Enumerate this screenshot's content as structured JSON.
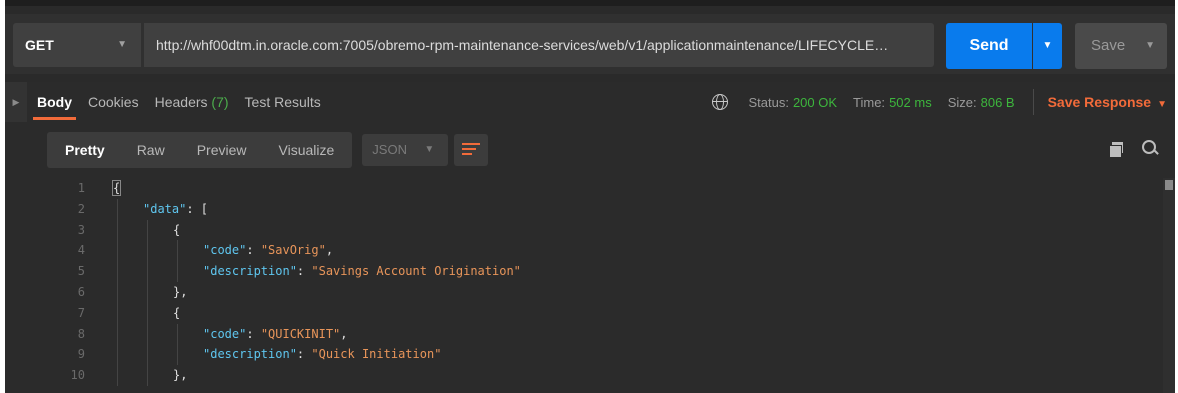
{
  "request": {
    "method": "GET",
    "url": "http://whf00dtm.in.oracle.com:7005/obremo-rpm-maintenance-services/web/v1/applicationmaintenance/LIFECYCLE…",
    "send_label": "Send",
    "save_label": "Save"
  },
  "response_tabs": [
    {
      "label": "Body",
      "count": ""
    },
    {
      "label": "Cookies",
      "count": ""
    },
    {
      "label": "Headers",
      "count": "(7)"
    },
    {
      "label": "Test Results",
      "count": ""
    }
  ],
  "status": {
    "status_label": "Status:",
    "status_value": "200 OK",
    "time_label": "Time:",
    "time_value": "502 ms",
    "size_label": "Size:",
    "size_value": "806 B",
    "save_response_label": "Save Response"
  },
  "body_toolbar": {
    "formats": [
      "Pretty",
      "Raw",
      "Preview",
      "Visualize"
    ],
    "language": "JSON"
  },
  "code_lines": [
    {
      "n": "1",
      "indent": 0,
      "parts": [
        [
          "punc",
          "{"
        ]
      ]
    },
    {
      "n": "2",
      "indent": 1,
      "parts": [
        [
          "key",
          "\"data\""
        ],
        [
          "punc",
          ": ["
        ]
      ]
    },
    {
      "n": "3",
      "indent": 2,
      "parts": [
        [
          "punc",
          "{"
        ]
      ]
    },
    {
      "n": "4",
      "indent": 3,
      "parts": [
        [
          "key",
          "\"code\""
        ],
        [
          "punc",
          ": "
        ],
        [
          "str",
          "\"SavOrig\""
        ],
        [
          "punc",
          ","
        ]
      ]
    },
    {
      "n": "5",
      "indent": 3,
      "parts": [
        [
          "key",
          "\"description\""
        ],
        [
          "punc",
          ": "
        ],
        [
          "str",
          "\"Savings Account Origination\""
        ]
      ]
    },
    {
      "n": "6",
      "indent": 2,
      "parts": [
        [
          "punc",
          "},"
        ]
      ]
    },
    {
      "n": "7",
      "indent": 2,
      "parts": [
        [
          "punc",
          "{"
        ]
      ]
    },
    {
      "n": "8",
      "indent": 3,
      "parts": [
        [
          "key",
          "\"code\""
        ],
        [
          "punc",
          ": "
        ],
        [
          "str",
          "\"QUICKINIT\""
        ],
        [
          "punc",
          ","
        ]
      ]
    },
    {
      "n": "9",
      "indent": 3,
      "parts": [
        [
          "key",
          "\"description\""
        ],
        [
          "punc",
          ": "
        ],
        [
          "str",
          "\"Quick Initiation\""
        ]
      ]
    },
    {
      "n": "10",
      "indent": 2,
      "parts": [
        [
          "punc",
          "},"
        ]
      ]
    }
  ],
  "colors": {
    "accent": "#097bed",
    "orange": "#f26b3a",
    "status_ok": "#3db63d"
  }
}
